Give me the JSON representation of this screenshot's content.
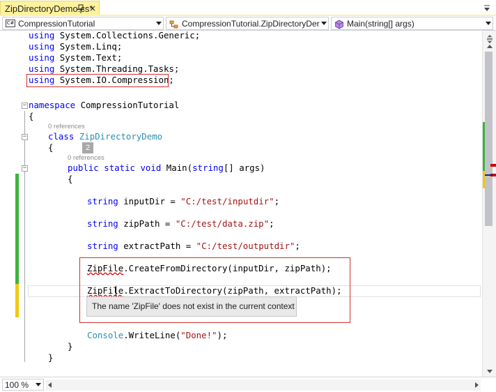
{
  "tab": {
    "title": "ZipDirectoryDemo.cs*",
    "close_glyph": "×",
    "active": true
  },
  "navbar": {
    "project": "CompressionTutorial",
    "class": "CompressionTutorial.ZipDirectoryDer",
    "member": "Main(string[] args)"
  },
  "code": {
    "using1": {
      "kw": "using",
      "rest": " System.Collections.Generic;"
    },
    "using2": {
      "kw": "using",
      "rest": " System.Linq;"
    },
    "using3": {
      "kw": "using",
      "rest": " System.Text;"
    },
    "using4": {
      "kw": "using",
      "rest": " System.Threading.Tasks;"
    },
    "using5": {
      "kw": "using",
      "rest": " System.IO.Compression;"
    },
    "ns": {
      "kw": "namespace",
      "rest": " CompressionTutorial"
    },
    "open1": "{",
    "lens_class": "0 references",
    "cls": {
      "kw": "class",
      "sp": " ",
      "name": "ZipDirectoryDemo"
    },
    "open2": "{",
    "badge": "2",
    "lens_main": "0 references",
    "main": {
      "kw1": "public",
      "sp1": " ",
      "kw2": "static",
      "sp2": " ",
      "kw3": "void",
      "mid": " Main(",
      "kw4": "string",
      "rest": "[] args)"
    },
    "open3": "{",
    "input": {
      "kw": "string",
      "mid": " inputDir = ",
      "str": "\"C:/test/inputdir\"",
      "end": ";"
    },
    "zip": {
      "kw": "string",
      "mid": " zipPath = ",
      "str": "\"C:/test/data.zip\"",
      "end": ";"
    },
    "extract": {
      "kw": "string",
      "mid": " extractPath = ",
      "str": "\"C:/test/outputdir\"",
      "end": ";"
    },
    "create": {
      "err": "ZipFile",
      "rest": ".CreateFromDirectory(inputDir, zipPath);"
    },
    "extract_call": {
      "err": "ZipFile",
      "rest": ".ExtractToDirectory(zipPath, extractPath);"
    },
    "console": {
      "ty": "Console",
      "mid": ".WriteLine(",
      "str": "\"Done!\"",
      "end": ");"
    },
    "close3": "}",
    "close2": "}"
  },
  "tooltip": "The name 'ZipFile' does not exist in the current context",
  "zoom": "100 %",
  "colors": {
    "keyword": "#0000ff",
    "type": "#2b91af",
    "string": "#a31515",
    "error_squiggle": "#e00000",
    "change_saved": "#3cb43c",
    "change_unsaved": "#f2c811",
    "annotation_box": "#d32f2f",
    "tab_active": "#fff29d"
  },
  "icons": {
    "pin": "pin-icon",
    "close": "close-icon",
    "tab_menu": "dropdown-icon",
    "project": "csharp-project-icon",
    "class": "class-icon",
    "member": "method-icon",
    "split": "split-handle-icon"
  }
}
